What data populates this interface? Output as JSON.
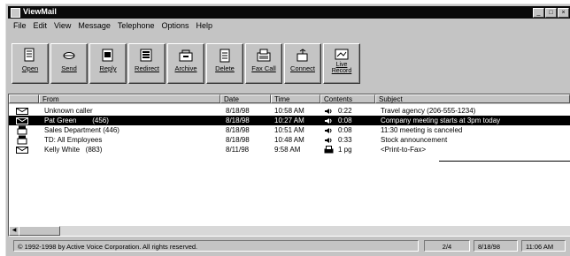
{
  "window": {
    "title": "ViewMail"
  },
  "window_buttons": [
    "_",
    "□",
    "×"
  ],
  "menu": [
    "File",
    "Edit",
    "View",
    "Message",
    "Telephone",
    "Options",
    "Help"
  ],
  "toolbar": [
    {
      "label": "Open",
      "icon": "open-icon"
    },
    {
      "label": "Send",
      "icon": "send-icon"
    },
    {
      "label": "Reply",
      "icon": "reply-icon"
    },
    {
      "label": "Redirect",
      "icon": "redirect-icon"
    },
    {
      "label": "Archive",
      "icon": "archive-icon"
    },
    {
      "label": "Delete",
      "icon": "delete-icon"
    },
    {
      "label": "Fax Call",
      "icon": "fax-call-icon"
    },
    {
      "label": "Connect",
      "icon": "connect-icon"
    },
    {
      "label": "Live",
      "label2": "Record",
      "icon": "live-record-icon"
    }
  ],
  "columns": [
    "From",
    "Date",
    "Time",
    "Contents",
    "Subject"
  ],
  "messages": [
    {
      "from": "Unknown caller",
      "date": "8/18/98",
      "time": "10:58 AM",
      "contents": "0:22",
      "subject": "Travel agency (206-555-1234)",
      "icon": "envelope",
      "ctype": "voice"
    },
    {
      "from": "Pat Green        (456)",
      "date": "8/18/98",
      "time": "10:27 AM",
      "contents": "0:08",
      "subject": "Company meeting starts at 3pm today",
      "icon": "envelope-open",
      "ctype": "voice"
    },
    {
      "from": "Sales Department (446)",
      "date": "8/18/98",
      "time": "10:51 AM",
      "contents": "0:08",
      "subject": "11:30 meeting is canceled",
      "icon": "phone",
      "ctype": "voice"
    },
    {
      "from": "TD: All Employees",
      "date": "8/18/98",
      "time": "10:48 AM",
      "contents": "0:33",
      "subject": "Stock announcement",
      "icon": "phone",
      "ctype": "voice"
    },
    {
      "from": "Kelly White   (883)",
      "date": "8/11/98",
      "time": "9:58 AM",
      "contents": "1 pg",
      "subject": "<Print-to-Fax>",
      "icon": "envelope",
      "ctype": "fax"
    }
  ],
  "status": {
    "copyright": "© 1992-1998 by Active Voice Corporation. All rights reserved.",
    "count": "2/4",
    "date": "8/18/98",
    "time": "11:06 AM"
  }
}
